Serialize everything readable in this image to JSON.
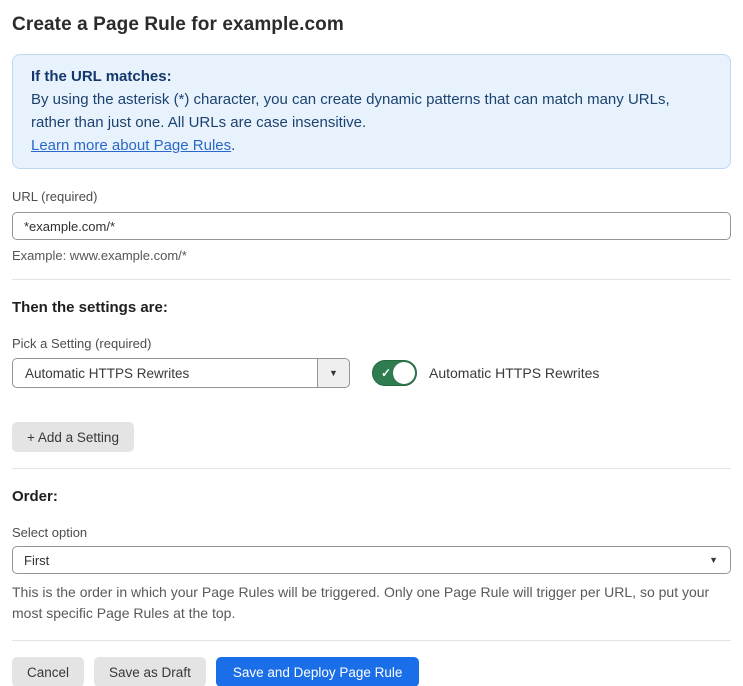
{
  "page": {
    "title": "Create a Page Rule for example.com"
  },
  "info_box": {
    "heading": "If the URL matches:",
    "body": "By using the asterisk (*) character, you can create dynamic patterns that can match many URLs, rather than just one. All URLs are case insensitive.",
    "link": "Learn more about Page Rules",
    "link_suffix": "."
  },
  "url_field": {
    "label": "URL (required)",
    "value": "*example.com/*",
    "helper": "Example: www.example.com/*"
  },
  "settings_section": {
    "heading": "Then the settings are:",
    "picker_label": "Pick a Setting (required)",
    "picker_value": "Automatic HTTPS Rewrites",
    "dropdown_arrow": "▼",
    "toggle": {
      "state": "on",
      "check": "✓",
      "label": "Automatic HTTPS Rewrites",
      "on_color": "#2e7c4f"
    },
    "add_button_label": "+ Add a Setting"
  },
  "order_section": {
    "heading": "Order:",
    "label": "Select option",
    "value": "First",
    "dropdown_arrow": "▼",
    "helper": "This is the order in which your Page Rules will be triggered. Only one Page Rule will trigger per URL, so put your most specific Page Rules at the top."
  },
  "footer": {
    "cancel_label": "Cancel",
    "save_draft_label": "Save as Draft",
    "save_deploy_label": "Save and Deploy Page Rule",
    "primary_color": "#1a6ee8"
  }
}
